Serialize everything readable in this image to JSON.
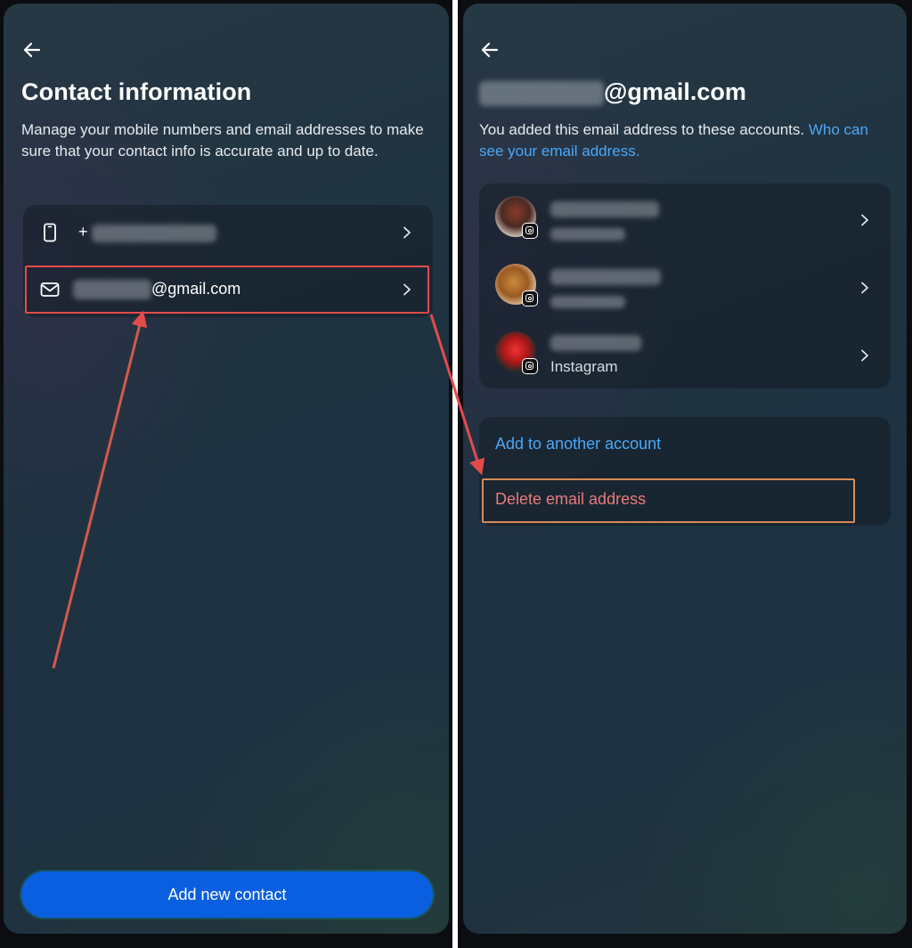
{
  "left": {
    "back_icon": "arrow-left-icon",
    "title": "Contact information",
    "subtitle": "Manage your mobile numbers and email addresses to make sure that your contact info is accurate and up to date.",
    "phone_prefix": "+",
    "email_suffix": "@gmail.com",
    "add_button": "Add new contact"
  },
  "right": {
    "title_suffix": "@gmail.com",
    "desc": "You added this email address to these accounts.",
    "desc_link": "Who can see your email address.",
    "accounts": [
      {
        "sub": ""
      },
      {
        "sub": ""
      },
      {
        "sub": "Instagram"
      }
    ],
    "add_action": "Add to another account",
    "delete_action": "Delete email address"
  },
  "colors": {
    "accent_blue": "#0a5fe0",
    "link_blue": "#4aa8f8",
    "annotation_red": "#e34b4b",
    "delete_red": "#ea7a7a"
  }
}
